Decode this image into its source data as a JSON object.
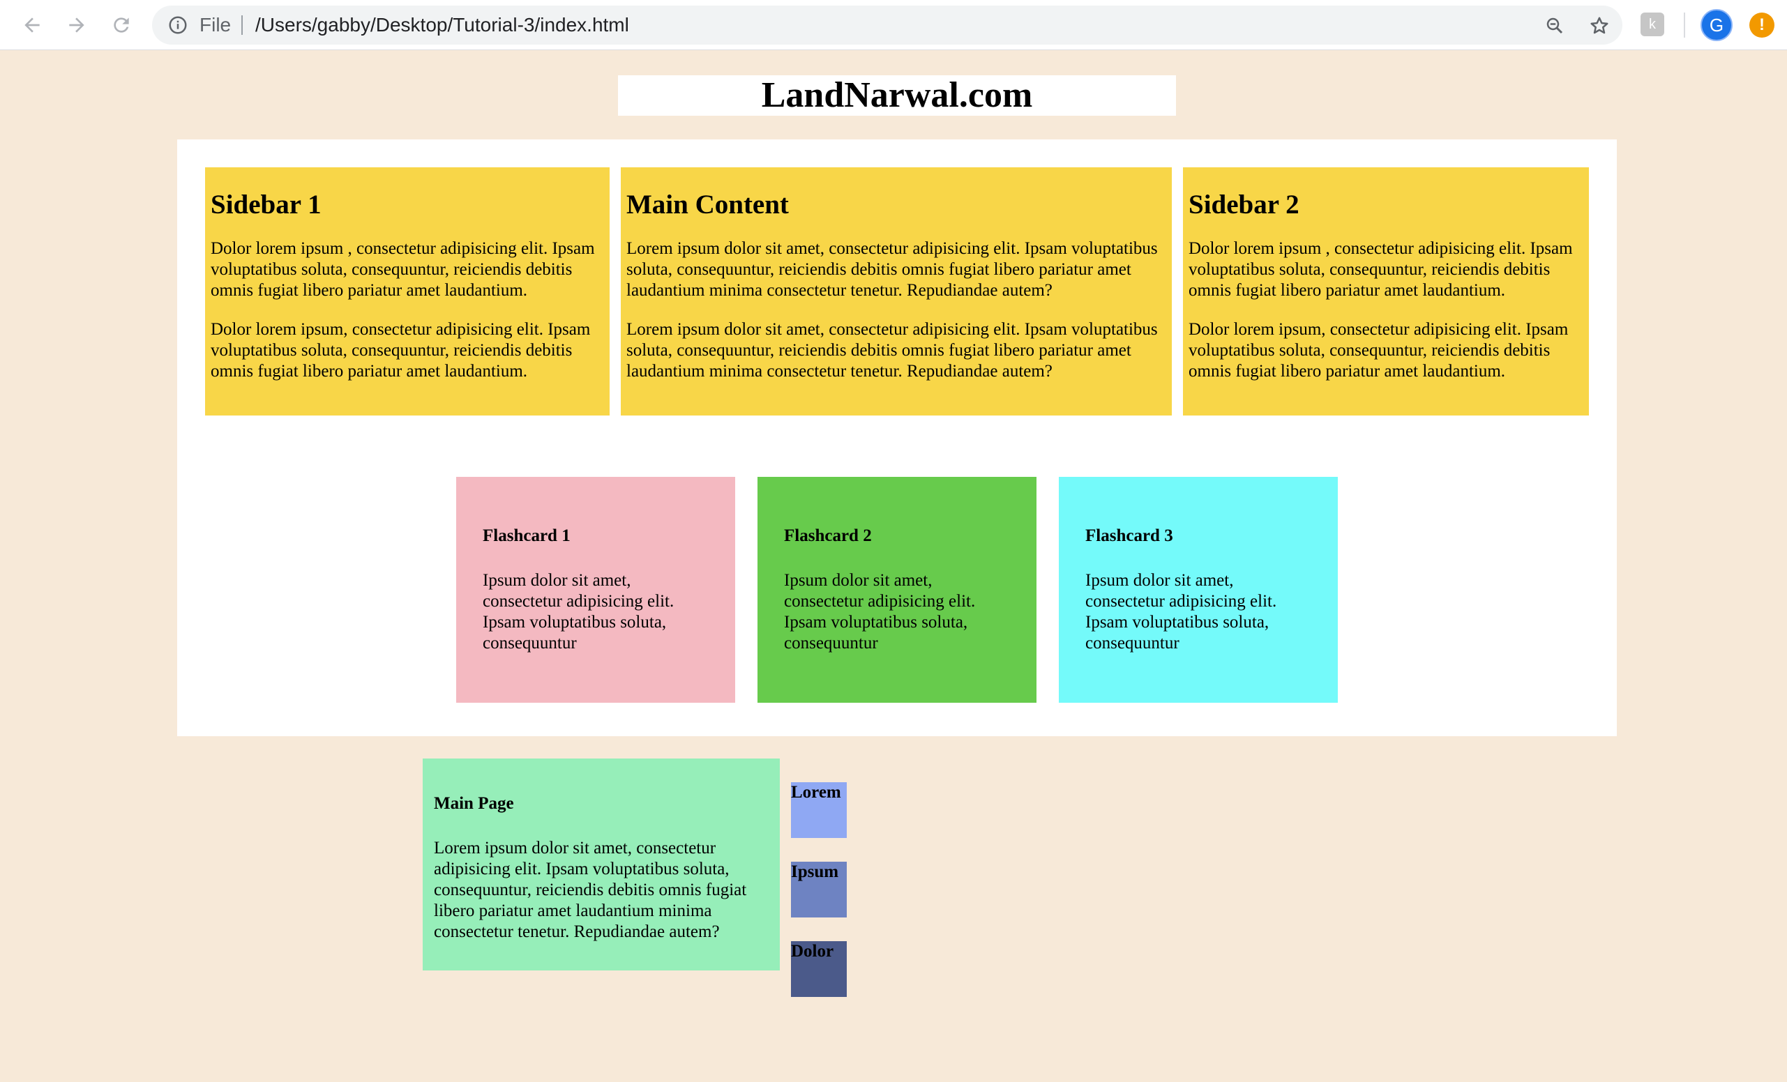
{
  "browser": {
    "file_label": "File",
    "url": "/Users/gabby/Desktop/Tutorial-3/index.html",
    "avatar_letter": "G",
    "extension_letter": "k",
    "alert_glyph": "!"
  },
  "page": {
    "title": "LandNarwal.com",
    "columns": [
      {
        "heading": "Sidebar 1",
        "paragraphs": [
          "Dolor lorem ipsum , consectetur adipisicing elit. Ipsam voluptatibus soluta, consequuntur, reiciendis debitis omnis fugiat libero pariatur amet laudantium.",
          "Dolor lorem ipsum, consectetur adipisicing elit. Ipsam voluptatibus soluta, consequuntur, reiciendis debitis omnis fugiat libero pariatur amet laudantium."
        ]
      },
      {
        "heading": "Main Content",
        "paragraphs": [
          "Lorem ipsum dolor sit amet, consectetur adipisicing elit. Ipsam voluptatibus soluta, consequuntur, reiciendis debitis omnis fugiat libero pariatur amet laudantium minima consectetur tenetur. Repudiandae autem?",
          "Lorem ipsum dolor sit amet, consectetur adipisicing elit. Ipsam voluptatibus soluta, consequuntur, reiciendis debitis omnis fugiat libero pariatur amet laudantium minima consectetur tenetur. Repudiandae autem?"
        ]
      },
      {
        "heading": "Sidebar 2",
        "paragraphs": [
          "Dolor lorem ipsum , consectetur adipisicing elit. Ipsam voluptatibus soluta, consequuntur, reiciendis debitis omnis fugiat libero pariatur amet laudantium.",
          "Dolor lorem ipsum, consectetur adipisicing elit. Ipsam voluptatibus soluta, consequuntur, reiciendis debitis omnis fugiat libero pariatur amet laudantium."
        ]
      }
    ],
    "flashcards": [
      {
        "heading": "Flashcard 1",
        "text": "Ipsum dolor sit amet, consectetur adipisicing elit. Ipsam voluptatibus soluta, consequuntur",
        "color": "#f4b9c1"
      },
      {
        "heading": "Flashcard 2",
        "text": "Ipsum dolor sit amet, consectetur adipisicing elit. Ipsam voluptatibus soluta, consequuntur",
        "color": "#67cb4c"
      },
      {
        "heading": "Flashcard 3",
        "text": "Ipsum dolor sit amet, consectetur adipisicing elit. Ipsam voluptatibus soluta, consequuntur",
        "color": "#74fafa"
      }
    ],
    "main_page": {
      "heading": "Main Page",
      "text": "Lorem ipsum dolor sit amet, consectetur adipisicing elit. Ipsam voluptatibus soluta, consequuntur, reiciendis debitis omnis fugiat libero pariatur amet laudantium minima consectetur tenetur. Repudiandae autem?"
    },
    "squares": [
      {
        "label": "Lorem",
        "color": "#8fa8f3"
      },
      {
        "label": "Ipsum",
        "color": "#6e83c2"
      },
      {
        "label": "Dolor",
        "color": "#4b5a8a"
      }
    ]
  },
  "colors": {
    "page_background": "#f7e9d8",
    "column_yellow": "#f8d648",
    "main_page_green": "#96eeb9"
  }
}
